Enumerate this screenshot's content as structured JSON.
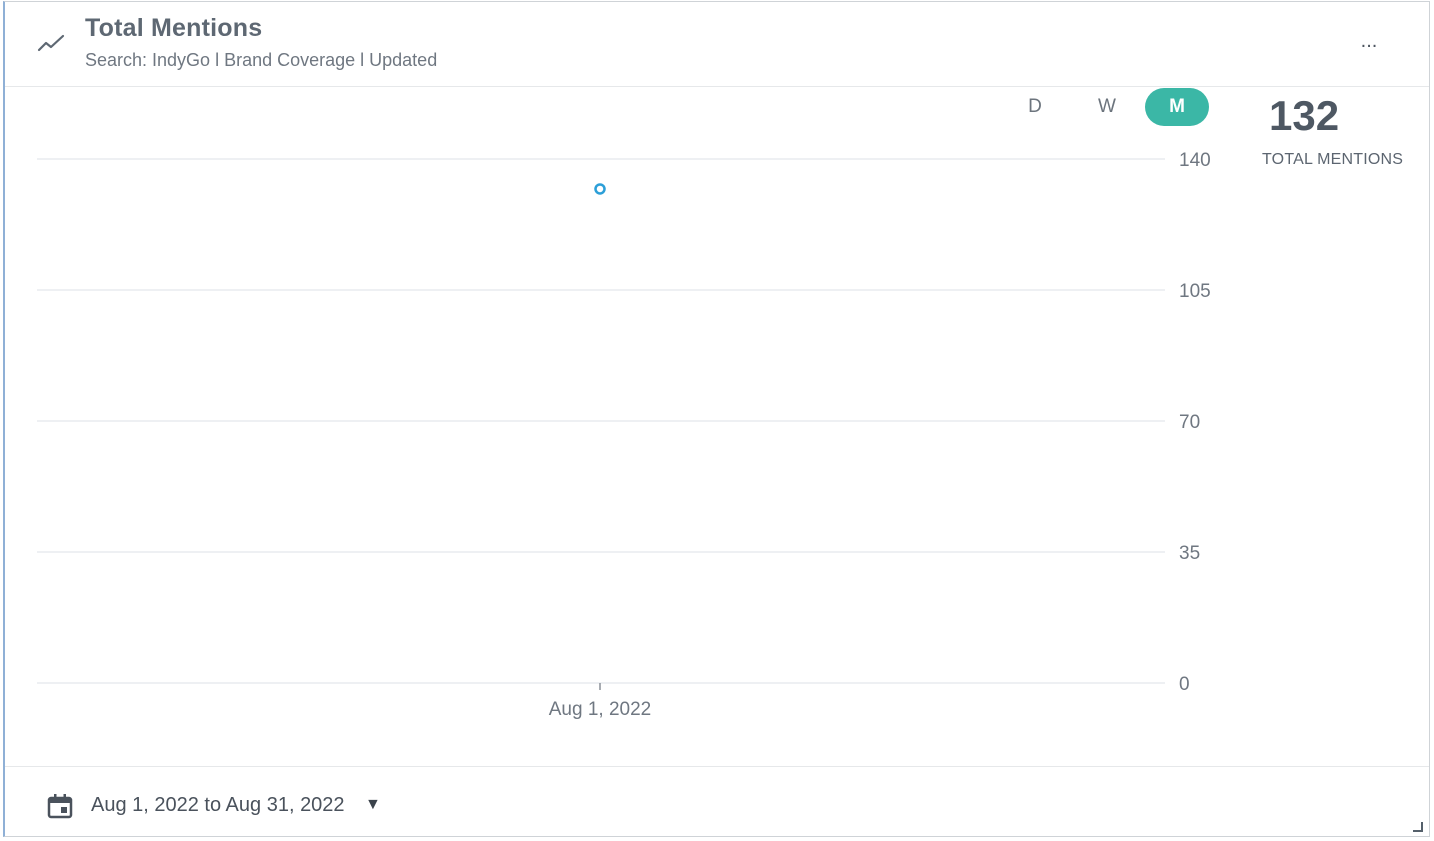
{
  "header": {
    "title": "Total Mentions",
    "subtitle": "Search: IndyGo l Brand Coverage l Updated",
    "more_label": "..."
  },
  "granularity": {
    "options": [
      "D",
      "W",
      "M"
    ],
    "selected": "M",
    "accent_color": "#3bb7a6"
  },
  "summary": {
    "value": "132",
    "label": "TOTAL MENTIONS"
  },
  "footer": {
    "date_range": "Aug 1, 2022 to Aug 31, 2022",
    "dropdown_icon": "▼"
  },
  "icons": {
    "trend": "trend-line-icon",
    "calendar": "calendar-icon",
    "more": "more-horizontal-icon",
    "resize": "resize-handle-icon"
  },
  "chart_data": {
    "type": "scatter",
    "x": [
      "Aug 1, 2022"
    ],
    "series": [
      {
        "values": [
          132
        ],
        "color": "#2c9fd8"
      }
    ],
    "ylim": [
      0,
      140
    ],
    "yticks": [
      "0",
      "35",
      "70",
      "105",
      "140"
    ],
    "xticks": [
      "Aug 1, 2022"
    ],
    "y_axis_position": "right",
    "grid": true,
    "title": "",
    "xlabel": "",
    "ylabel": ""
  }
}
